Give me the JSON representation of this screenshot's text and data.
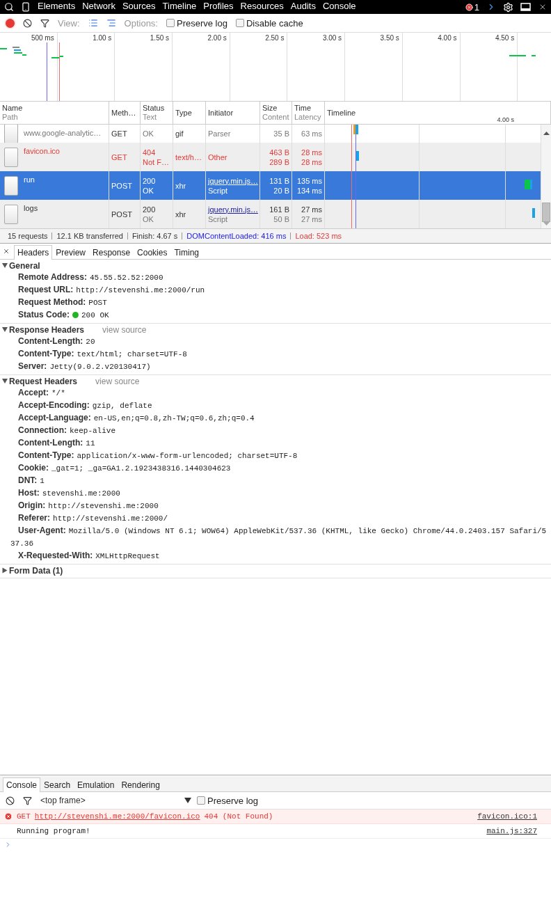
{
  "toolbar": {
    "tabs": [
      {
        "label": "Elements"
      },
      {
        "label": "Network"
      },
      {
        "label": "Sources"
      },
      {
        "label": "Timeline"
      },
      {
        "label": "Profiles"
      },
      {
        "label": "Resources"
      },
      {
        "label": "Audits"
      },
      {
        "label": "Console"
      }
    ],
    "error_count": "1"
  },
  "network_toolbar": {
    "recording": true,
    "view_label": "View:",
    "options_label": "Options:",
    "options": [
      {
        "label": "Preserve log",
        "checked": false
      },
      {
        "label": "Disable cache",
        "checked": false
      }
    ]
  },
  "overview": {
    "ticks": [
      "500 ms",
      "1.00 s",
      "1.50 s",
      "2.00 s",
      "2.50 s",
      "3.00 s",
      "3.50 s",
      "4.00 s",
      "4.50 s"
    ]
  },
  "table": {
    "columns": [
      {
        "title": "Name",
        "subtitle": "Path"
      },
      {
        "title": "Meth…"
      },
      {
        "title": "Status",
        "subtitle": "Text"
      },
      {
        "title": "Type"
      },
      {
        "title": "Initiator"
      },
      {
        "title": "Size",
        "subtitle": "Content"
      },
      {
        "title": "Time",
        "subtitle": "Latency"
      },
      {
        "title": "Timeline"
      }
    ],
    "timeline_tick": "4.00 s",
    "rows": [
      {
        "path": "www.google-analytic…",
        "method": "GET",
        "status_text": "OK",
        "type": "gif",
        "initiator_type": "Parser",
        "content": "35 B",
        "latency": "63 ms",
        "selected": false,
        "failed": false
      },
      {
        "name": "favicon.ico",
        "method": "GET",
        "status": "404",
        "status_text": "Not F…",
        "type": "text/h…",
        "initiator_type": "Other",
        "size": "463 B",
        "content": "289 B",
        "time": "28 ms",
        "latency": "28 ms",
        "selected": false,
        "failed": true
      },
      {
        "name": "run",
        "method": "POST",
        "status": "200",
        "status_text": "OK",
        "type": "xhr",
        "initiator": "jquery.min.js…",
        "initiator_type": "Script",
        "size": "131 B",
        "content": "20 B",
        "time": "135 ms",
        "latency": "134 ms",
        "selected": true,
        "failed": false
      },
      {
        "name": "logs",
        "method": "POST",
        "status": "200",
        "status_text": "OK",
        "type": "xhr",
        "initiator": "jquery.min.js…",
        "initiator_type": "Script",
        "size": "161 B",
        "content": "50 B",
        "time": "27 ms",
        "latency": "27 ms",
        "selected": false,
        "failed": false
      }
    ]
  },
  "summary": {
    "requests": "15 requests",
    "transferred": "12.1 KB transferred",
    "finish": "Finish: 4.67 s",
    "dom_content_loaded": "DOMContentLoaded: 416 ms",
    "load": "Load: 523 ms"
  },
  "details": {
    "tabs": [
      {
        "label": "Headers",
        "selected": true
      },
      {
        "label": "Preview",
        "selected": false
      },
      {
        "label": "Response",
        "selected": false
      },
      {
        "label": "Cookies",
        "selected": false
      },
      {
        "label": "Timing",
        "selected": false
      }
    ],
    "sections": [
      {
        "title": "General",
        "expanded": true,
        "headers": [
          {
            "name": "Remote Address:",
            "value": "45.55.52.52:2000"
          },
          {
            "name": "Request URL:",
            "value": "http://stevenshi.me:2000/run"
          },
          {
            "name": "Request Method:",
            "value": "POST"
          },
          {
            "name": "Status Code:",
            "value": "200 OK",
            "color": "#22b422"
          }
        ]
      },
      {
        "title": "Response Headers",
        "link": "view source",
        "expanded": true,
        "headers": [
          {
            "name": "Content-Length:",
            "value": "20"
          },
          {
            "name": "Content-Type:",
            "value": "text/html; charset=UTF-8"
          },
          {
            "name": "Server:",
            "value": "Jetty(9.0.2.v20130417)"
          }
        ]
      },
      {
        "title": "Request Headers",
        "link": "view source",
        "expanded": true,
        "headers": [
          {
            "name": "Accept:",
            "value": "*/*"
          },
          {
            "name": "Accept-Encoding:",
            "value": "gzip, deflate"
          },
          {
            "name": "Accept-Language:",
            "value": "en-US,en;q=0.8,zh-TW;q=0.6,zh;q=0.4"
          },
          {
            "name": "Connection:",
            "value": "keep-alive"
          },
          {
            "name": "Content-Length:",
            "value": "11"
          },
          {
            "name": "Content-Type:",
            "value": "application/x-www-form-urlencoded; charset=UTF-8"
          },
          {
            "name": "Cookie:",
            "value": "_gat=1; _ga=GA1.2.1923438316.1440304623"
          },
          {
            "name": "DNT:",
            "value": "1"
          },
          {
            "name": "Host:",
            "value": "stevenshi.me:2000"
          },
          {
            "name": "Origin:",
            "value": "http://stevenshi.me:2000"
          },
          {
            "name": "Referer:",
            "value": "http://stevenshi.me:2000/"
          },
          {
            "name": "User-Agent:",
            "value": "Mozilla/5.0 (Windows NT 6.1; WOW64) AppleWebKit/537.36 (KHTML, like Gecko) Chrome/44.0.2403.157 Safari/537.36"
          },
          {
            "name": "X-Requested-With:",
            "value": "XMLHttpRequest"
          }
        ]
      },
      {
        "title": "Form Data (1)",
        "expanded": false
      }
    ]
  },
  "console": {
    "tabs": [
      {
        "label": "Console",
        "selected": true
      },
      {
        "label": "Search",
        "selected": false
      },
      {
        "label": "Emulation",
        "selected": false
      },
      {
        "label": "Rendering",
        "selected": false
      }
    ],
    "context": "<top frame>",
    "preserve_log": {
      "label": "Preserve log",
      "checked": false
    },
    "messages": [
      {
        "kind": "error",
        "method": "GET",
        "url": "http://stevenshi.me:2000/favicon.ico",
        "text": "404 (Not Found)",
        "source": "favicon.ico:1"
      },
      {
        "kind": "log",
        "text": "Running program!",
        "source": "main.js:327"
      }
    ]
  }
}
